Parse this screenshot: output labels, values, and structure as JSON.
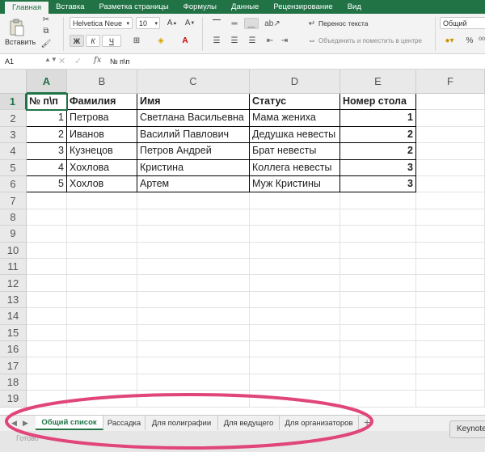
{
  "ribbon_tabs": [
    "Главная",
    "Вставка",
    "Разметка страницы",
    "Формулы",
    "Данные",
    "Рецензирование",
    "Вид"
  ],
  "ribbon": {
    "paste_label": "Вставить",
    "font_name": "Helvetica Neue",
    "font_size": "10",
    "bold": "Ж",
    "italic": "К",
    "underline": "Ч",
    "wrap_text": "Перенос текста",
    "merge_center": "Объединить и поместить в центре",
    "number_format": "Общий",
    "percent": "%"
  },
  "formula_bar": {
    "cell_ref": "A1",
    "fx": "fx",
    "content": "№ п\\п"
  },
  "columns": [
    "A",
    "B",
    "C",
    "D",
    "E",
    "F"
  ],
  "rows": [
    "1",
    "2",
    "3",
    "4",
    "5",
    "6",
    "7",
    "8",
    "9",
    "10",
    "11",
    "12",
    "13",
    "14",
    "15",
    "16",
    "17",
    "18",
    "19"
  ],
  "table": {
    "headers": [
      "№ п\\п",
      "Фамилия",
      "Имя",
      "Статус",
      "Номер стола"
    ],
    "rows": [
      [
        "1",
        "Петрова",
        "Светлана Васильевна",
        "Мама жениха",
        "1"
      ],
      [
        "2",
        "Иванов",
        "Василий Павлович",
        "Дедушка невесты",
        "2"
      ],
      [
        "3",
        "Кузнецов",
        "Петров Андрей",
        "Брат невесты",
        "2"
      ],
      [
        "4",
        "Хохлова",
        "Кристина",
        "Коллега невесты",
        "3"
      ],
      [
        "5",
        "Хохлов",
        "Артем",
        "Муж Кристины",
        "3"
      ]
    ]
  },
  "sheet_tabs": [
    "Общий список",
    "Рассадка",
    "Для полиграфии",
    "Для ведущего",
    "Для организаторов"
  ],
  "active_sheet": "Общий список",
  "add_sheet": "+",
  "status": "Готово",
  "keynote_tooltip": "Keynote",
  "colors": {
    "accent": "#217346",
    "annotation": "#e0457b"
  }
}
